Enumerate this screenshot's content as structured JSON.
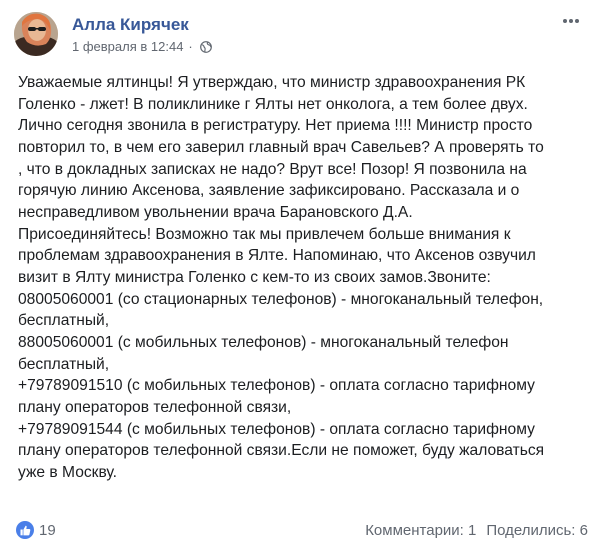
{
  "post": {
    "author": {
      "name": "Алла Кирячек",
      "avatar_icon": "profile-photo"
    },
    "date": "1 февраля в 12:44",
    "separator": "·",
    "privacy_icon": "globe-icon",
    "more_icon": "more-dots-icon",
    "body_lines": [
      "Уважаемые ялтинцы! Я утверждаю, что министр здравоохранения РК",
      "Голенко - лжет! В поликлинике г Ялты нет онколога, а тем более двух.",
      "Лично сегодня звонила в регистратуру. Нет приема !!!! Министр просто",
      "повторил то, в чем его заверил главный врач Савельев? А проверять то",
      ", что в докладных записках не надо? Врут все! Позор! Я позвонила на",
      "горячую линию Аксенова, заявление зафиксировано. Рассказала и о",
      "несправедливом увольнении врача Барановского Д.А.",
      "Присоединяйтесь! Возможно так мы привлечем больше внимания к",
      "проблемам здравоохранения в Ялте. Напоминаю, что Аксенов озвучил",
      "визит в Ялту министра Голенко с кем-то из своих замов.Звоните:",
      "08005060001 (со стационарных телефонов) - многоканальный телефон,",
      "бесплатный,",
      "88005060001 (с мобильных телефонов) - многоканальный телефон",
      "бесплатный,",
      "+79789091510 (с мобильных телефонов) - оплата согласно тарифному",
      "плану операторов телефонной связи,",
      "+79789091544 (с мобильных телефонов) - оплата согласно тарифному",
      "плану операторов телефонной связи.Если не поможет, буду жаловаться",
      "уже в Москву."
    ],
    "reactions": {
      "icon": "like-icon",
      "count": "19"
    },
    "comments_label": "Комментарии: 1",
    "shares_label": "Поделились: 6",
    "colors": {
      "author": "#385898",
      "meta": "#616770",
      "text": "#1c1e21",
      "like": "#4a7fe8"
    }
  }
}
